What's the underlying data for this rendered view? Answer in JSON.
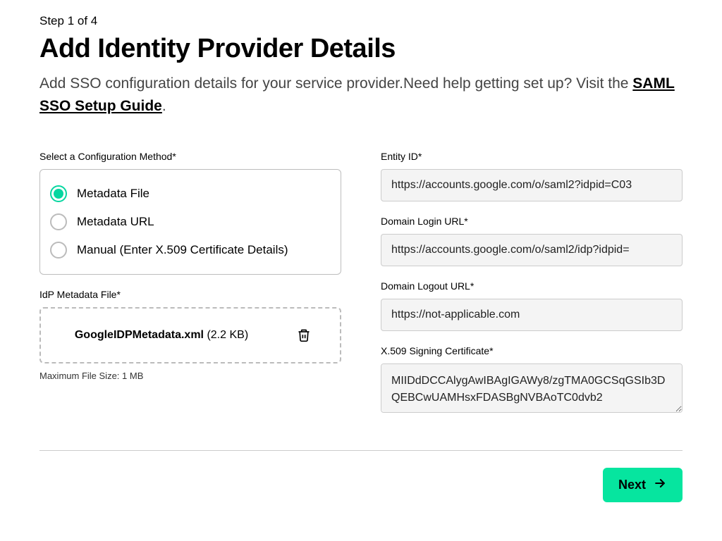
{
  "step": "Step 1 of 4",
  "title": "Add Identity Provider Details",
  "subtitle_text1": "Add SSO configuration details for your service provider.",
  "subtitle_text2": "Need help getting set up? Visit the ",
  "subtitle_link": "SAML SSO Setup Guide",
  "subtitle_period": ".",
  "left": {
    "config_label": "Select a Configuration Method*",
    "options": {
      "file": "Metadata File",
      "url": "Metadata URL",
      "manual": "Manual (Enter X.509 Certificate Details)"
    },
    "selected": "file",
    "metadata_label": "IdP Metadata File*",
    "uploaded_file_name": "GoogleIDPMetadata.xml",
    "uploaded_file_size": "(2.2 KB)",
    "max_size_hint": "Maximum File Size: 1 MB"
  },
  "right": {
    "entity_label": "Entity ID*",
    "entity_value": "https://accounts.google.com/o/saml2?idpid=C03",
    "login_label": "Domain Login URL*",
    "login_value": "https://accounts.google.com/o/saml2/idp?idpid=",
    "logout_label": "Domain Logout URL*",
    "logout_value": "https://not-applicable.com",
    "cert_label": "X.509 Signing Certificate*",
    "cert_value": "MIIDdDCCAlygAwIBAgIGAWy8/zgTMA0GCSqGSIb3DQEBCwUAMHsxFDASBgNVBAoTC0dvb2"
  },
  "footer": {
    "next": "Next"
  }
}
